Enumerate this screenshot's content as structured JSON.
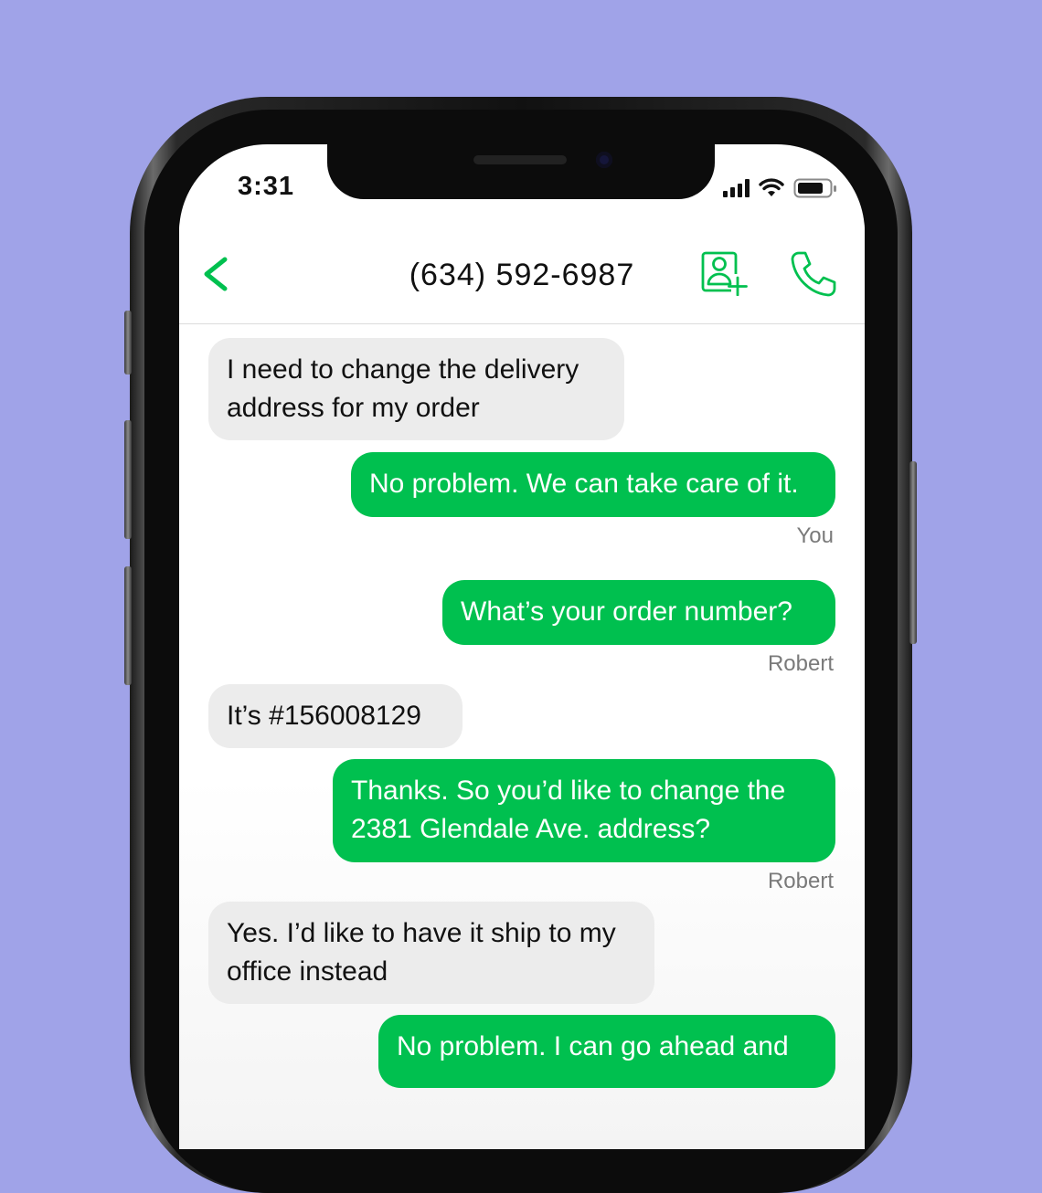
{
  "status_bar": {
    "time": "3:31"
  },
  "header": {
    "title": "(634) 592-6987"
  },
  "messages": [
    {
      "dir": "in",
      "lines": [
        "I need to change the delivery",
        "address for my order"
      ]
    },
    {
      "dir": "out",
      "lines": [
        "No problem. We can take care of it."
      ],
      "sender": "You"
    },
    {
      "dir": "out",
      "lines": [
        "What’s your order number?"
      ],
      "sender": "Robert"
    },
    {
      "dir": "in",
      "lines": [
        "It’s #156008129"
      ]
    },
    {
      "dir": "out",
      "lines": [
        "Thanks. So you’d like to change the",
        "2381 Glendale Ave. address?"
      ],
      "sender": "Robert"
    },
    {
      "dir": "in",
      "lines": [
        "Yes. I’d like to have it ship to my",
        "office instead"
      ]
    },
    {
      "dir": "out",
      "lines": [
        "No problem. I can go ahead and"
      ]
    }
  ],
  "colors": {
    "accent": "#00c04f",
    "incoming_bubble": "#ececec",
    "background": "#a0a3e8"
  },
  "icons": [
    "back-chevron-icon",
    "add-contact-icon",
    "phone-call-icon",
    "signal-icon",
    "wifi-icon",
    "battery-icon"
  ]
}
